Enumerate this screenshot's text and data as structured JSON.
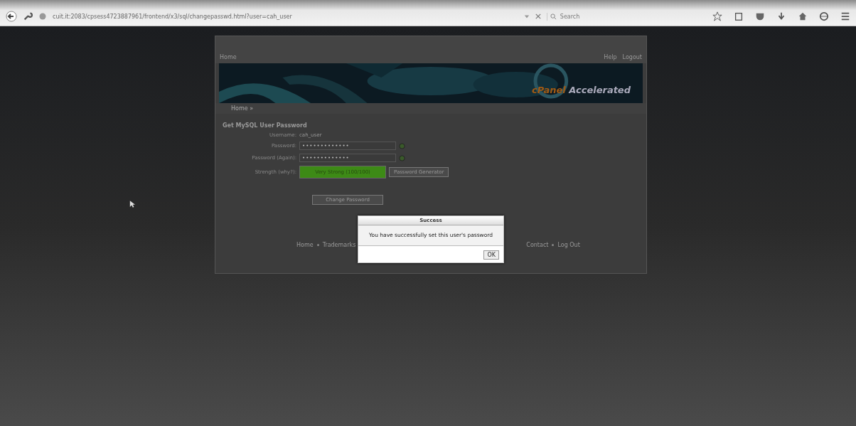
{
  "browser": {
    "url": "cuit.it:2083/cpsess4723887961/frontend/x3/sql/changepasswd.html?user=cah_user",
    "search": {
      "placeholder": "Search"
    }
  },
  "cpanel": {
    "top_left": "Home",
    "top_right": [
      "Help",
      "Logout"
    ],
    "banner_brand": "cPanel",
    "banner_text": "Accelerated",
    "breadcrumb": "Home »",
    "heading": "Get MySQL User Password",
    "fields": [
      {
        "label": "Username:",
        "kind": "text",
        "value": "cah_user"
      },
      {
        "label": "Password:",
        "kind": "password",
        "value": "•••••••••••••"
      },
      {
        "label": "Password (Again):",
        "kind": "password",
        "value": "•••••••••••••"
      },
      {
        "label": "Strength (why?):",
        "kind": "strength",
        "value": "Very Strong (100/100)",
        "level": 1,
        "button": "Password Generator"
      }
    ],
    "submit": "Change Password",
    "footer_left": [
      "Home",
      "Trademarks"
    ],
    "footer_right": [
      "Contact",
      "Log Out"
    ]
  },
  "dialog": {
    "title": "Success",
    "message": "You have successfully set this user's password",
    "button": "OK"
  }
}
